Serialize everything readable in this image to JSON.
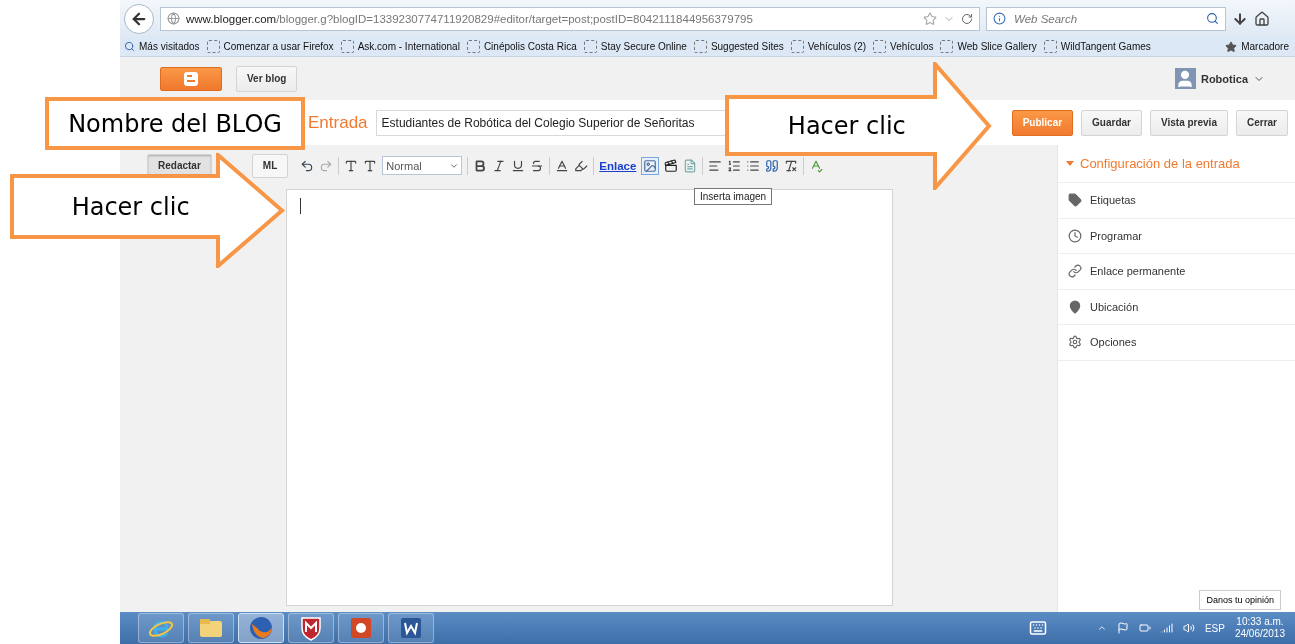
{
  "browser": {
    "url_host": "www.blogger.com",
    "url_path": "/blogger.g?blogID=1339230774711920829#editor/target=post;postID=8042111844956379795",
    "search": {
      "placeholder": "Web Search"
    },
    "bookmarks": [
      {
        "label": "Más visitados",
        "kind": "special"
      },
      {
        "label": "Comenzar a usar Firefox",
        "kind": "page"
      },
      {
        "label": "Ask.com - International",
        "kind": "page"
      },
      {
        "label": "Cinépolis Costa Rica",
        "kind": "page"
      },
      {
        "label": "Stay Secure Online",
        "kind": "page"
      },
      {
        "label": "Suggested Sites",
        "kind": "page"
      },
      {
        "label": "Vehículos (2)",
        "kind": "page"
      },
      {
        "label": "Vehículos",
        "kind": "page"
      },
      {
        "label": "Web Slice Gallery",
        "kind": "page"
      },
      {
        "label": "WildTangent Games",
        "kind": "page"
      }
    ],
    "bookmarks_menu": "Marcadore"
  },
  "header": {
    "view_blog": "Ver blog",
    "user": "Robotica"
  },
  "post": {
    "section": "Entrada",
    "title": "Estudiantes de Robótica del Colegio Superior de Señoritas",
    "actions": [
      {
        "label": "Publicar",
        "kind": "primary"
      },
      {
        "label": "Guardar",
        "kind": "plain"
      },
      {
        "label": "Vista previa",
        "kind": "plain"
      },
      {
        "label": "Cerrar",
        "kind": "plain"
      }
    ]
  },
  "modes": [
    {
      "label": "Redactar",
      "selected": true
    },
    {
      "label": "ML",
      "selected": false
    }
  ],
  "toolbar": {
    "font_size": "Normal",
    "link": "Enlace",
    "image_highlighted": true,
    "tooltip": "Inserta imagen"
  },
  "sidebar": {
    "heading": "Configuración de la entrada",
    "expanded": true,
    "items": [
      {
        "label": "Etiquetas",
        "kind": "tag"
      },
      {
        "label": "Programar",
        "kind": "clock"
      },
      {
        "label": "Enlace permanente",
        "kind": "link"
      },
      {
        "label": "Ubicación",
        "kind": "pin"
      },
      {
        "label": "Opciones",
        "kind": "gear"
      }
    ]
  },
  "feedback": "Danos tu opinión",
  "taskbar": {
    "apps": [
      {
        "kind": "ie",
        "selected": false
      },
      {
        "kind": "folder",
        "selected": false
      },
      {
        "kind": "firefox",
        "selected": true
      },
      {
        "kind": "shield",
        "selected": false
      },
      {
        "kind": "slides",
        "selected": false
      },
      {
        "kind": "word",
        "selected": false
      }
    ],
    "language": "ESP",
    "time": "10:33 a.m.",
    "date": "24/06/2013"
  },
  "callouts": [
    {
      "kind": "box",
      "text": "Nombre del BLOG"
    },
    {
      "kind": "arrow",
      "text": "Hacer clic"
    },
    {
      "kind": "arrow",
      "text": "Hacer clic"
    }
  ]
}
